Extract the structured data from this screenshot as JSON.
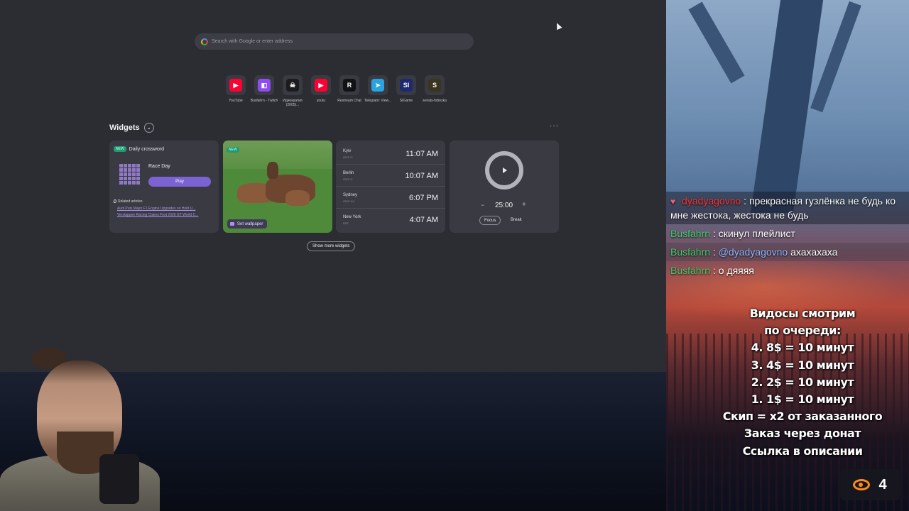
{
  "search": {
    "placeholder": "Search with Google or enter address"
  },
  "speed_dial": [
    {
      "label": "YouTube",
      "icon": "youtube-icon",
      "color": "#ff0033",
      "glyph": "▶"
    },
    {
      "label": "Busfahrn - Twitch",
      "icon": "twitch-icon",
      "color": "#8f4cf0",
      "glyph": "◧"
    },
    {
      "label": "Идиократия (2005)...",
      "icon": "pirate-icon",
      "color": "#1c1c1f",
      "glyph": "☠"
    },
    {
      "label": "youtu",
      "icon": "youtube-icon",
      "color": "#ff0033",
      "glyph": "▶"
    },
    {
      "label": "Restream Chat",
      "icon": "restream-icon",
      "color": "#111214",
      "glyph": "R"
    },
    {
      "label": "Telegram: View...",
      "icon": "telegram-icon",
      "color": "#2aa3df",
      "glyph": "➤"
    },
    {
      "label": "SIGame",
      "icon": "sigame-icon",
      "color": "#1d2a6e",
      "glyph": "SI"
    },
    {
      "label": "serials-hdrezka",
      "icon": "hdrezka-icon",
      "color": "#3a3520",
      "glyph": "S"
    }
  ],
  "widgets": {
    "title": "Widgets",
    "crossword": {
      "badge": "NEW",
      "title": "Daily crossword",
      "name": "Race Day",
      "play_label": "Play",
      "related_label": "Related articles",
      "links": [
        "Audi Puts Major F1 Engine Upgrades on Hold U...",
        "Verstappen Racing Claims First 2026 GT World C..."
      ]
    },
    "photo": {
      "badge": "NEW",
      "wallpaper_label": "Set wallpaper"
    },
    "clocks": [
      {
        "city": "Kyiv",
        "gmt": "GMT+3",
        "time": "11:07 AM"
      },
      {
        "city": "Berlin",
        "gmt": "GMT+2",
        "time": "10:07 AM"
      },
      {
        "city": "Sydney",
        "gmt": "GMT+10",
        "time": "6:07 PM"
      },
      {
        "city": "New York",
        "gmt": "EDT",
        "time": "4:07 AM"
      }
    ],
    "timer": {
      "minus": "−",
      "value": "25:00",
      "plus": "+",
      "focus_label": "Focus",
      "break_label": "Break"
    },
    "more_label": "Show more widgets"
  },
  "chat": [
    {
      "user": "dyadyagovno",
      "sep": " : ",
      "text": "прекрасная гузлёнка не будь ко мне жестока, жестока не будь",
      "user_color": "#ff3030"
    },
    {
      "user": "Busfahrn",
      "sep": " : ",
      "text": "скинул плейлист",
      "user_color": "#3ecf6a"
    },
    {
      "user": "Busfahrn",
      "sep": " : ",
      "mention": "@dyadyagovno",
      "text": " ахахахаха",
      "user_color": "#3ecf6a"
    },
    {
      "user": "Busfahrn",
      "sep": " : ",
      "text": "о дяяяя",
      "user_color": "#3ecf6a"
    }
  ],
  "queue": {
    "lines": [
      "Видосы смотрим",
      "по очереди:",
      "4. 8$ = 10 минут",
      "3. 4$ = 10 минут",
      "2. 2$ = 10 минут",
      "1. 1$ = 10 минут",
      "Скип = x2 от заказанного",
      "Заказ через донат",
      "Ссылка в описании"
    ]
  },
  "viewers": {
    "count": "4",
    "icon": "eye-icon",
    "color": "#ff8a1c"
  }
}
